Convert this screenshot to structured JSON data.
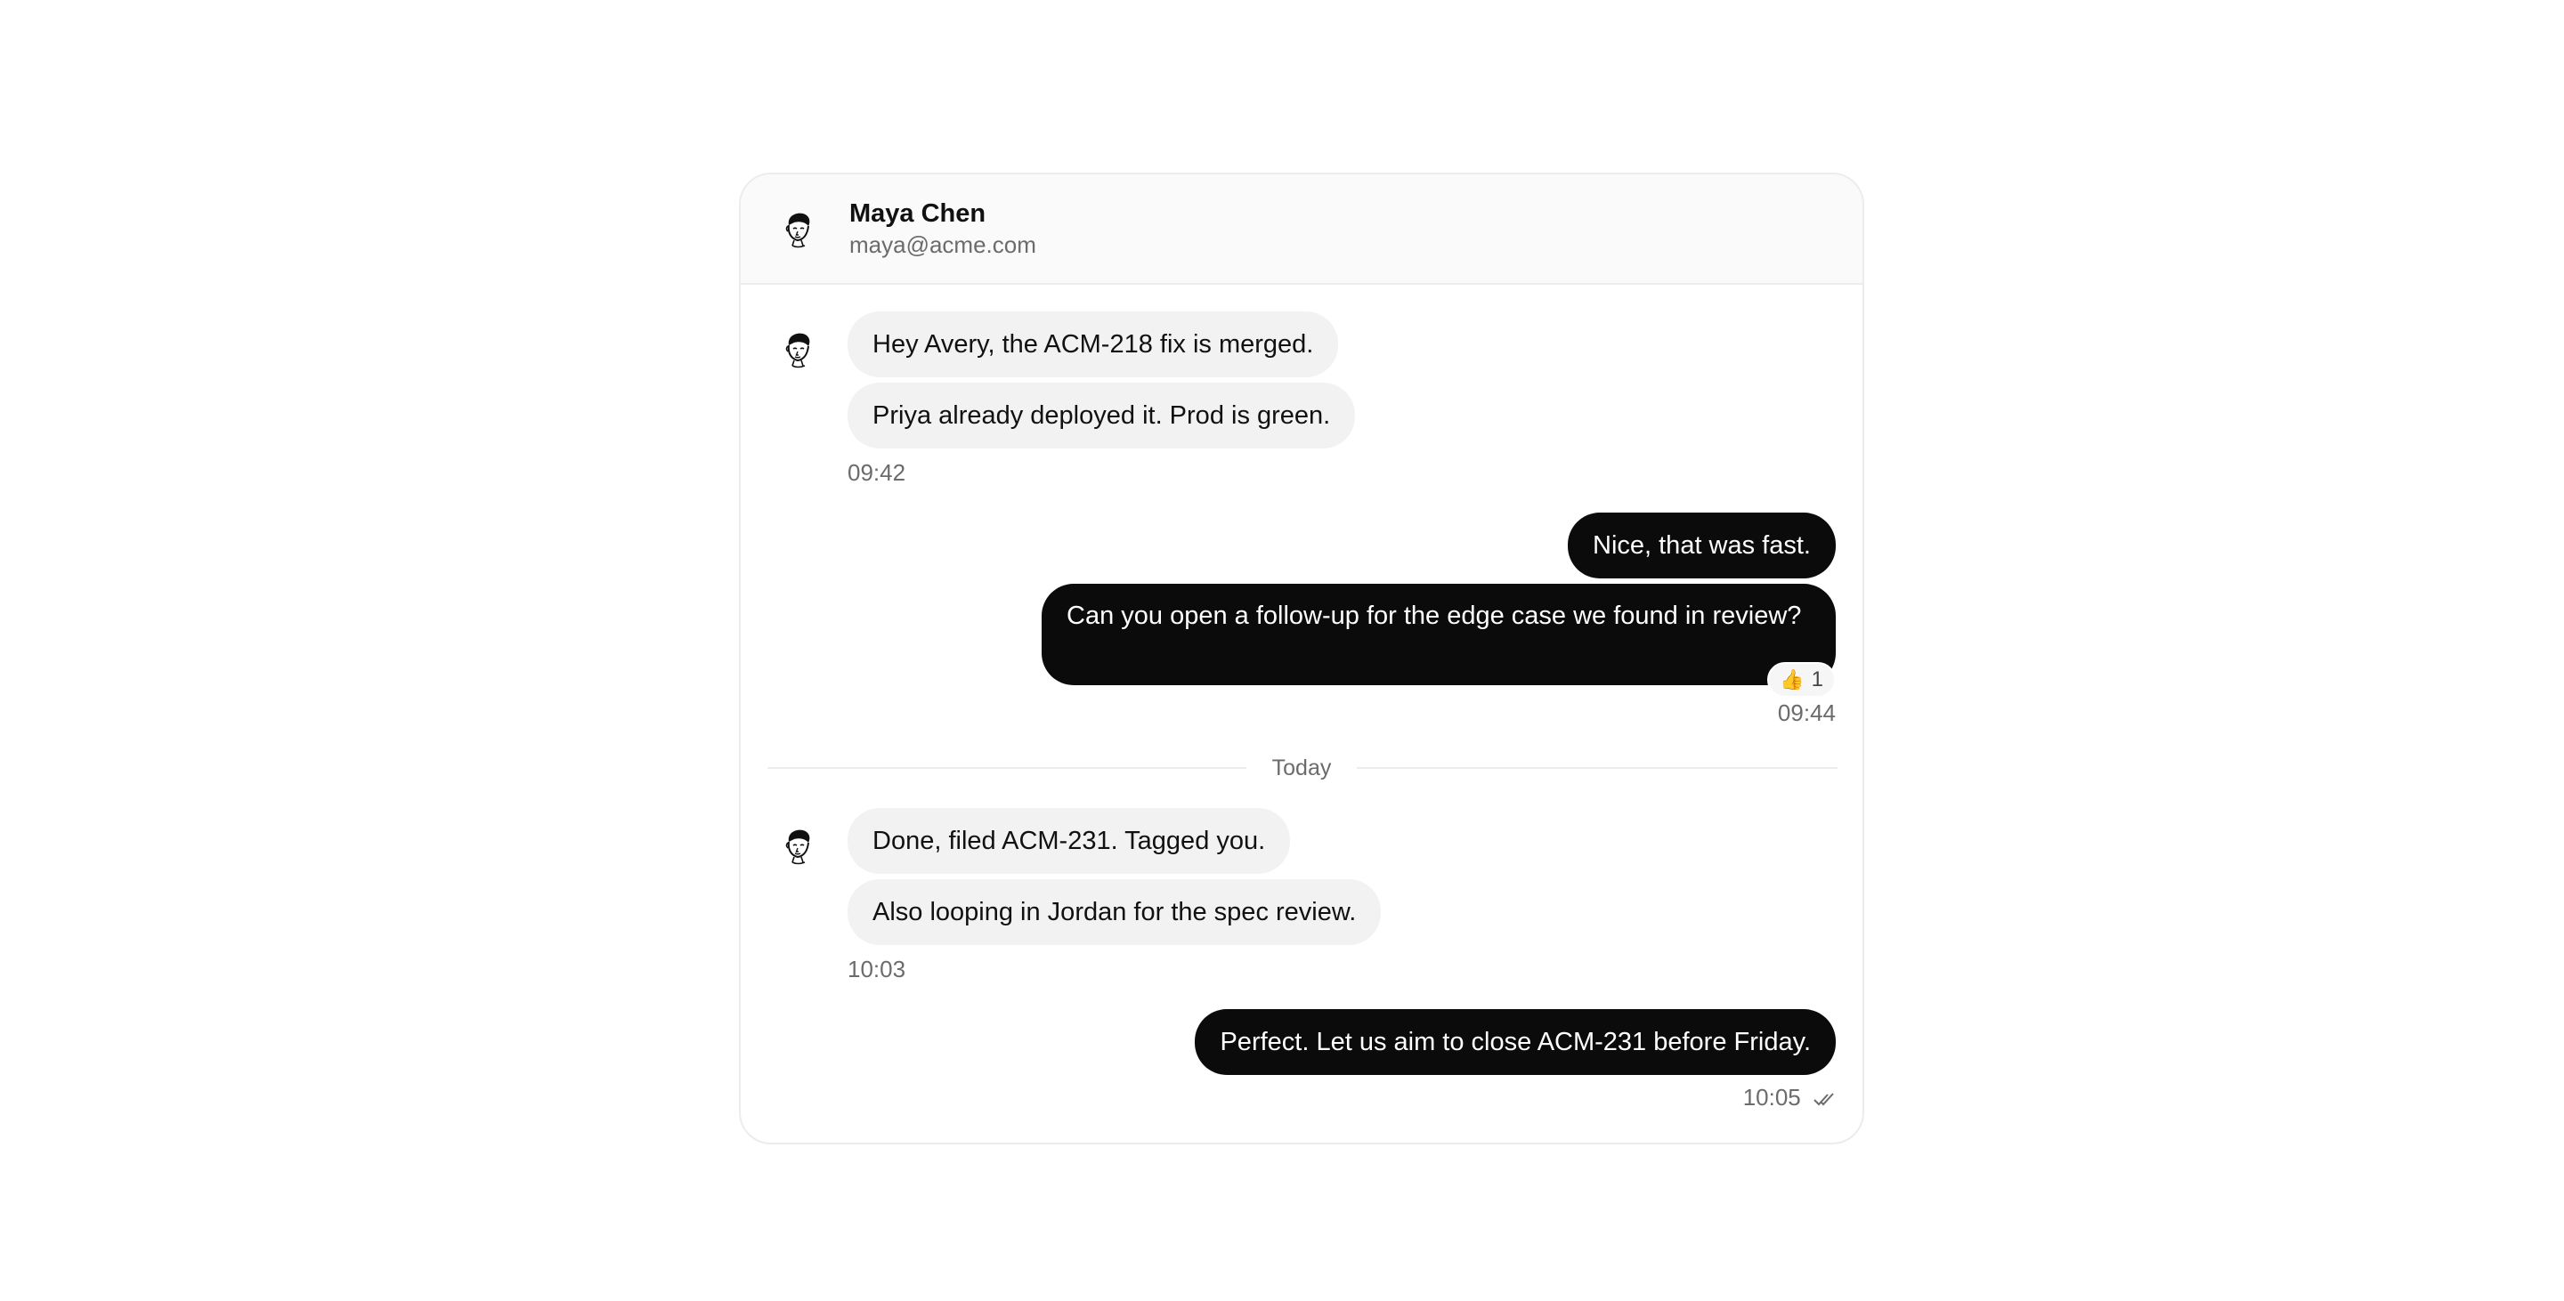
{
  "header": {
    "name": "Maya Chen",
    "email": "maya@acme.com",
    "avatar_icon": "person-sketch-icon"
  },
  "groups": [
    {
      "direction": "incoming",
      "messages": [
        "Hey Avery, the ACM-218 fix is merged.",
        "Priya already deployed it. Prod is green."
      ],
      "time": "09:42"
    },
    {
      "direction": "outgoing",
      "messages": [
        "Nice, that was fast.",
        "Can you open a follow-up for the edge case we found in review?"
      ],
      "reaction": {
        "emoji": "👍",
        "count": "1"
      },
      "time": "09:44"
    },
    {
      "direction": "incoming",
      "messages": [
        "Done, filed ACM-231. Tagged you.",
        "Also looping in Jordan for the spec review."
      ],
      "time": "10:03"
    },
    {
      "direction": "outgoing",
      "messages": [
        "Perfect. Let us aim to close ACM-231 before Friday."
      ],
      "time": "10:05",
      "status_icon": "double-check-icon"
    }
  ],
  "divider": {
    "label": "Today"
  },
  "colors": {
    "outgoing_bubble": "#0b0b0b",
    "incoming_bubble": "#f2f2f2",
    "header_bg": "#fafafa",
    "border": "#ececec",
    "muted_text": "#6b6b6b"
  }
}
